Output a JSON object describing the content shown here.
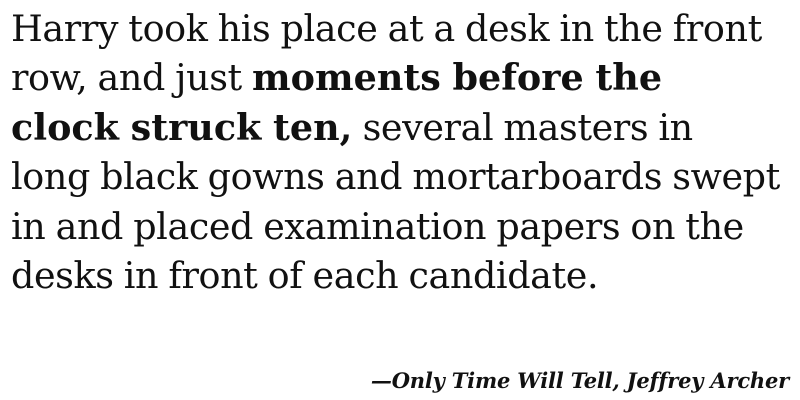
{
  "quote": {
    "line1": "Harry took his place at a desk in the front",
    "line2_regular": "row, and just ",
    "line2_bold": "moments before the",
    "line3_bold": "clock struck ten,",
    "line3_regular": " several masters in",
    "line4": "long black gowns and mortarboards swept",
    "line5": "in and placed examination papers on the",
    "line6": "desks in front of each candidate."
  },
  "attribution": "—Only Time Will Tell, Jeffrey Archer"
}
